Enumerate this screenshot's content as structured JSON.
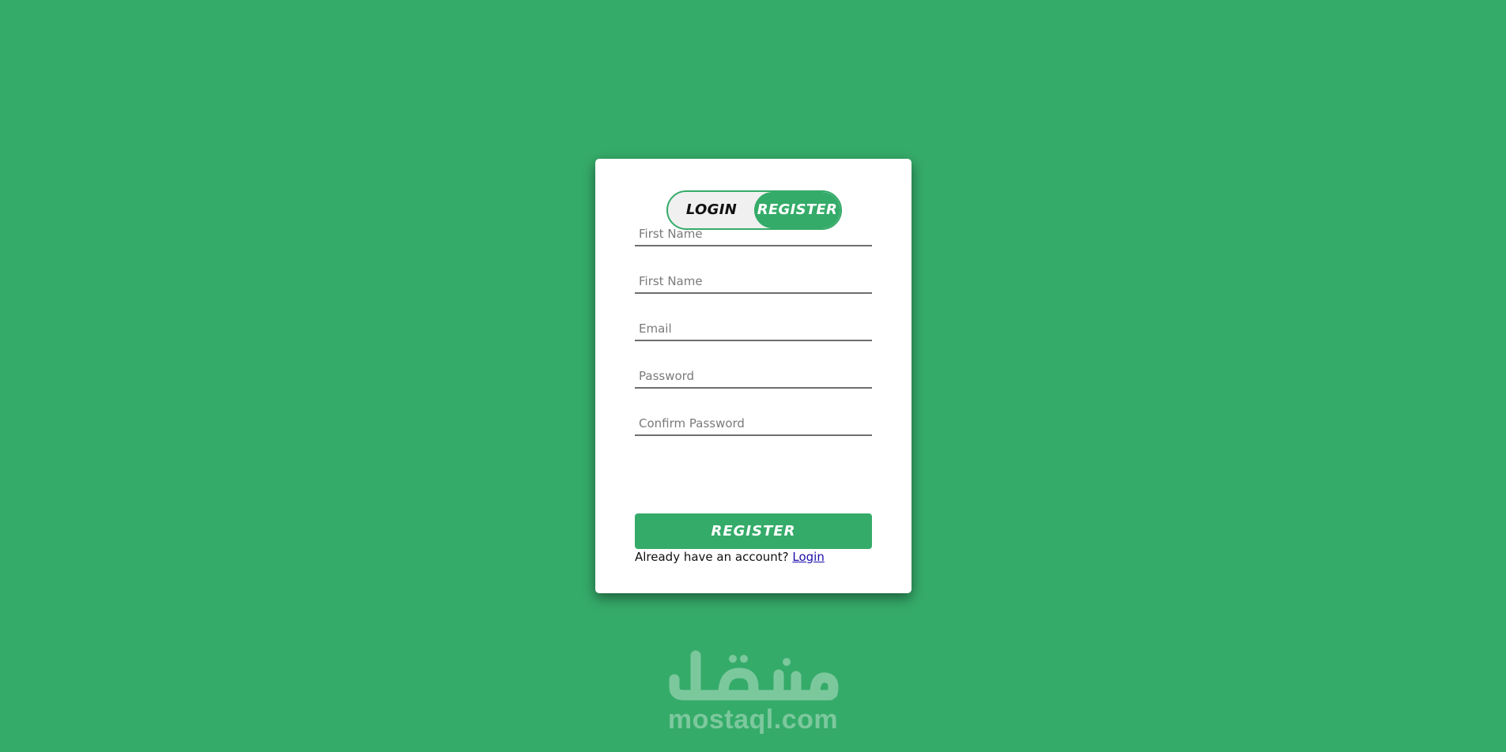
{
  "toggle": {
    "login_label": "LOGIN",
    "register_label": "REGISTER",
    "active": "register"
  },
  "form": {
    "fields": [
      {
        "placeholder": "First Name",
        "value": ""
      },
      {
        "placeholder": "First Name",
        "value": ""
      },
      {
        "placeholder": "Email",
        "value": ""
      },
      {
        "placeholder": "Password",
        "value": ""
      },
      {
        "placeholder": "Confirm Password",
        "value": ""
      }
    ],
    "submit_label": "REGISTER",
    "footer_text": "Already have an account? ",
    "footer_link": "Login"
  },
  "watermark": {
    "arabic": "مستقل",
    "domain": "mostaql.com"
  },
  "colors": {
    "background": "#35ab69",
    "accent": "#35ab69",
    "card": "#ffffff",
    "link": "#1a0dab"
  }
}
